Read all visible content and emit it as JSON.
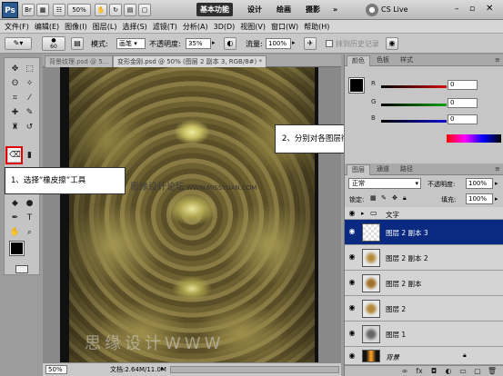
{
  "app": {
    "logo": "Ps",
    "zoom_combo": "50%",
    "workspaces": [
      "基本功能",
      "设计",
      "绘画",
      "摄影"
    ],
    "active_workspace": "基本功能",
    "cs_live": "CS Live"
  },
  "menu": [
    "文件(F)",
    "编辑(E)",
    "图像(I)",
    "图层(L)",
    "选择(S)",
    "滤镜(T)",
    "分析(A)",
    "3D(D)",
    "视图(V)",
    "窗口(W)",
    "帮助(H)"
  ],
  "options": {
    "brush_size": "60",
    "mode_label": "模式:",
    "mode_value": "画笔",
    "opacity_label": "不透明度:",
    "opacity_value": "35%",
    "flow_label": "流量:",
    "flow_value": "100%",
    "history_label": "抹到历史记录"
  },
  "document": {
    "tabs": [
      "背景纹理.psd @ 5...",
      "变形金刚.psd @ 50% (图层 2 副本 3, RGB/8#) *"
    ],
    "active_tab": 1,
    "zoom": "50%",
    "status": "文档:2.64M/11.0M"
  },
  "watermark": {
    "site": "思缘设计论坛",
    "url": "WWW.MISSYUAN.COM",
    "big": "思缘设计WWW"
  },
  "callouts": {
    "step1": "1、选择“橡皮擦”工具",
    "step2": "2、分别对各图层衔接处进行擦除"
  },
  "color_panel": {
    "tabs": [
      "颜色",
      "色板",
      "样式"
    ],
    "channels": [
      {
        "label": "R",
        "value": "0",
        "color": "#d01010"
      },
      {
        "label": "G",
        "value": "0",
        "color": "#10a010"
      },
      {
        "label": "B",
        "value": "0",
        "color": "#1010d0"
      }
    ]
  },
  "layers_panel": {
    "tabs": [
      "图层",
      "通道",
      "路径"
    ],
    "blend_mode": "正常",
    "opacity_label": "不透明度:",
    "opacity_value": "100%",
    "lock_label": "锁定:",
    "fill_label": "填充:",
    "fill_value": "100%",
    "layers": [
      {
        "name": "文字",
        "type": "group",
        "selected": false
      },
      {
        "name": "图层 2 副本 3",
        "type": "layer",
        "selected": true
      },
      {
        "name": "图层 2 副本 2",
        "type": "layer",
        "selected": false
      },
      {
        "name": "图层 2 副本",
        "type": "layer",
        "selected": false
      },
      {
        "name": "图层 2",
        "type": "layer",
        "selected": false
      },
      {
        "name": "图层 1",
        "type": "layer",
        "selected": false
      },
      {
        "name": "背景",
        "type": "background",
        "selected": false
      }
    ]
  }
}
